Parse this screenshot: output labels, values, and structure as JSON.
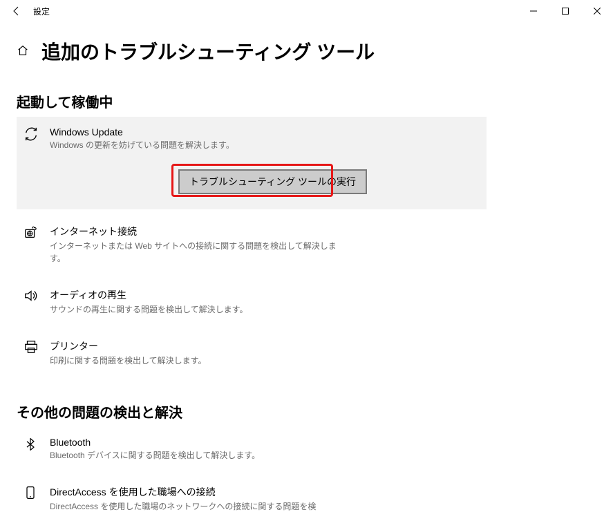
{
  "window": {
    "title": "設定"
  },
  "page": {
    "heading": "追加のトラブルシューティング ツール"
  },
  "sections": {
    "running": {
      "heading": "起動して稼働中"
    },
    "other": {
      "heading": "その他の問題の検出と解決"
    }
  },
  "troubleshooters": {
    "windows_update": {
      "title": "Windows Update",
      "desc": "Windows の更新を妨げている問題を解決します。",
      "run_label": "トラブルシューティング ツールの実行"
    },
    "internet": {
      "title": "インターネット接続",
      "desc": "インターネットまたは Web サイトへの接続に関する問題を検出して解決します。"
    },
    "audio": {
      "title": "オーディオの再生",
      "desc": "サウンドの再生に関する問題を検出して解決します。"
    },
    "printer": {
      "title": "プリンター",
      "desc": "印刷に関する問題を検出して解決します。"
    },
    "bluetooth": {
      "title": "Bluetooth",
      "desc": "Bluetooth デバイスに関する問題を検出して解決します。"
    },
    "directaccess": {
      "title": "DirectAccess を使用した職場への接続",
      "desc": "DirectAccess を使用した職場のネットワークへの接続に関する問題を検"
    }
  }
}
